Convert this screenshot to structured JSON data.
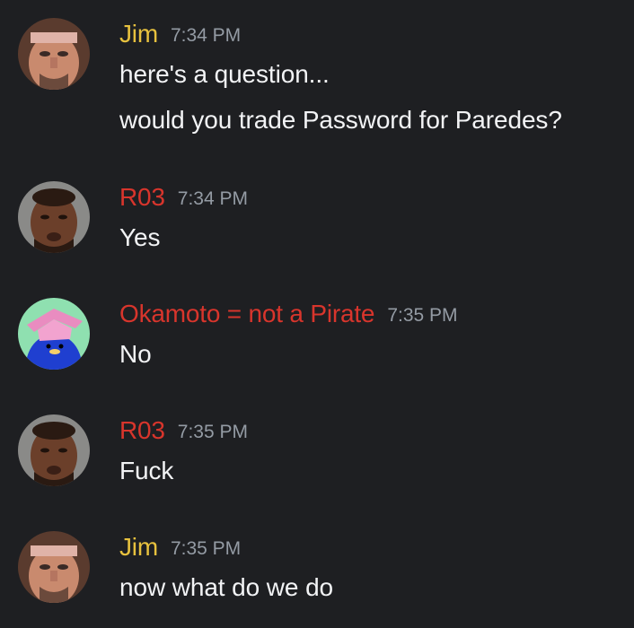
{
  "colors": {
    "background": "#1e1f22",
    "text": "#f2f3f5",
    "timestamp": "#949ba4",
    "jim": "#e7c13e",
    "r03": "#d8352c",
    "okamoto": "#d8352c"
  },
  "messages": [
    {
      "username": "Jim",
      "timestamp": "7:34 PM",
      "avatar": "jim-avatar",
      "lines": [
        "here's a question...",
        "would you trade Password for Paredes?"
      ]
    },
    {
      "username": "R03",
      "timestamp": "7:34 PM",
      "avatar": "r03-avatar",
      "lines": [
        "Yes"
      ]
    },
    {
      "username": "Okamoto = not a Pirate",
      "timestamp": "7:35 PM",
      "avatar": "okamoto-avatar",
      "lines": [
        "No"
      ]
    },
    {
      "username": "R03",
      "timestamp": "7:35 PM",
      "avatar": "r03-avatar",
      "lines": [
        "Fuck"
      ]
    },
    {
      "username": "Jim",
      "timestamp": "7:35 PM",
      "avatar": "jim-avatar",
      "lines": [
        "now what do we do"
      ]
    }
  ]
}
